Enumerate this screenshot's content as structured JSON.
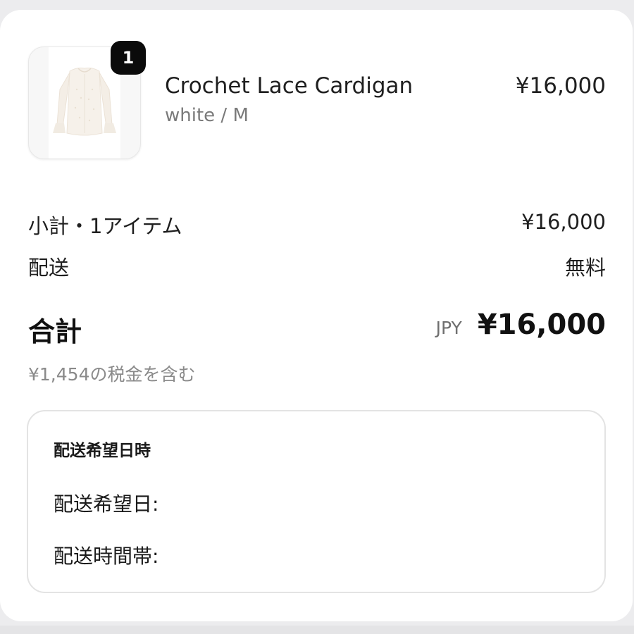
{
  "product": {
    "quantity": "1",
    "name": "Crochet Lace Cardigan",
    "variant": "white / M",
    "price": "¥16,000",
    "image_icon": "cardigan-thumbnail"
  },
  "summary": {
    "subtotal_label": "小計・1アイテム",
    "subtotal_value": "¥16,000",
    "shipping_label": "配送",
    "shipping_value": "無料",
    "total_label": "合計",
    "currency": "JPY",
    "total_value": "¥16,000",
    "tax_note": "¥1,454の税金を含む"
  },
  "delivery": {
    "title": "配送希望日時",
    "date_label": "配送希望日:",
    "time_label": "配送時間帯:"
  },
  "colors": {
    "badge": "#0b0b0b",
    "muted_text": "#8a8a8a",
    "border": "#e3e3e3"
  }
}
